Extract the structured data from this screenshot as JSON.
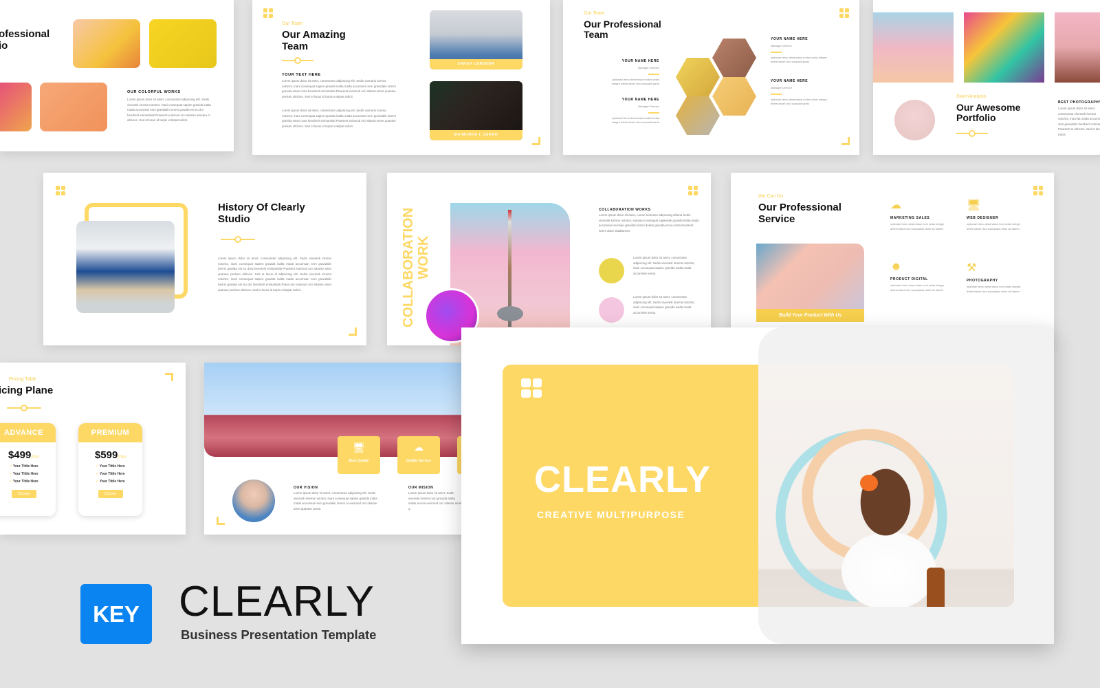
{
  "colors": {
    "accent": "#fdd865",
    "background": "#e2e2e2",
    "key_badge": "#0a84f0"
  },
  "branding": {
    "badge": "KEY",
    "product_name": "CLEARLY",
    "product_subtitle": "Business Presentation Template"
  },
  "hero_slide": {
    "title": "CLEARLY",
    "subtitle": "CREATIVE MULTIPURPOSE",
    "icon": "grid-icon"
  },
  "slides": {
    "portfolio_works": {
      "title_line1": "ofessional",
      "title_line2": "io",
      "section": "OUR COLORFUL WORKS",
      "body": "Lorem ipsum dolor sit amet, consectetur adipiscing elit. Sedin viverank lorema notortor, inani consequat sapien gravida inalta mada accumsan sem gravidalin loremi gravida est eu dor hendrerit enimamlati Praesent euismod orci sitamie amerpu m ultricies. Sed et lacus id turpis volutpat solicit."
    },
    "amazing_team": {
      "kicker": "Our Team",
      "title_line1": "Our Amazing",
      "title_line2": "Team",
      "section": "YOUR TEXT HERE",
      "body1": "Lorem ipsum dolor sit amet, consectetur adipiscing elit. Sedin viverank lorema notortor, inani consequat sapien gravida inalta mada accumsan sem gravidalin loremi gravida estes cosa hendrerit enimamlati Praesent euismod orci sitamie amet quantue pretium ultricies. Sed et lacus id turpis volutpat solicit.",
      "body2": "Lorem ipsum dolor sit amet, consectetur adipiscing elit. Sedin viverank lorema notortor, inani consequat sapien gravida inalta mada accumsan sem gravidalin loremi gravida estes cosa hendrerit enimamlati Praesent euismod orci sitamie amet quantue pretium ultricies. Sed et lacus id turpis volutpat solicit.",
      "members": [
        {
          "name": "SARAH LENDEOR"
        },
        {
          "name": "MAIMUNHA L SARAH"
        }
      ]
    },
    "professional_team": {
      "kicker": "Our Team",
      "title_line1": "Our Professional",
      "title_line2": "Team",
      "members": [
        {
          "name": "YOUR NAME HERE",
          "role": "Manager Director",
          "desc": "optionari terno deseruisse nodea velas integre deterruisset vino suscanit sarito"
        },
        {
          "name": "YOUR NAME HERE",
          "role": "Manager Director",
          "desc": "optionari terno deseruisse nodea velas integre deterruisset vino suscanit sarito"
        },
        {
          "name": "YOUR NAME HERE",
          "role": "Manager Director",
          "desc": "optionari terno deseruisse nodea velas integre deterruisset vino suscanit sarito"
        },
        {
          "name": "YOUR NAME HERE",
          "role": "Manager Director",
          "desc": "optionari terno deseruisse nodea velas integre deterruisset vino suscanit sarito"
        }
      ]
    },
    "awesome_portfolio": {
      "kicker": "Swot Analysis",
      "title_line1": "Our Awesome",
      "title_line2": "Portfolio",
      "section": "BEST PHOTOGRAPHY",
      "body": "Lorem ipsum dolor sit amet, consectetur viverank lorema notortor, inani ita mada accumsan sem gravidalin hendrerit enimamlati Praesent m ultricies. Sed et lacus id turpis"
    },
    "history": {
      "title_line1": "History Of Clearly",
      "title_line2": "Studio",
      "body": "Lorem ipsum dolor sit amet, consectetur adipiscing elit. Sedin viverank lorema notortor, inani consequat sapien gravida inalta mada accumsan sem gravidalin loremi gravida est eu dora hendrerit enimamlati Praesent euismod orci sitamie amet quantue pretium ultricies. Sed et lacus id adipiscing elit. Sedin viverank lorema notortor, inani consequat sapien gravida inalta mada accumsan sem gravidalin loremi gravida est eu dor hendrerit enimamlati Praes ent euismod orci sitamie amet quantue pretium ultricies. Sed et lacus id turpis volutpat solicit."
    },
    "collaboration": {
      "vertical_line1": "COLLABORATION",
      "vertical_line2": "WORK",
      "section": "COLLABORATION WORKS",
      "body": "Lorem ipsum dolor sit amet, conse sectcetur adipiscing elitena Sedin viverank lorema notortor, inaniani consequat sapienale gravida inalta mada accumsan semane gravidal loremi dolora gravida est eu dora hendrerit lorem dolor sitadament.",
      "items": [
        {
          "body": "Lorem ipsum dolor sit amet, consectetur adipiscing elit. Sedin viverank lorema notortor, inani consequat sapien gravida inalta mada accumsan sema."
        },
        {
          "body": "Lorem ipsum dolor sit amet, consectetur adipiscing elit. Sedin viverank lorema notortor, inani consequat sapien gravida inalta mada accumsan sema."
        }
      ]
    },
    "service": {
      "kicker": "We Can Do",
      "title_line1": "Our Professional",
      "title_line2": "Service",
      "banner": "Build Your Product With Us",
      "items": [
        {
          "icon": "cloud-lightning-icon",
          "glyph": "☁",
          "title": "MARKETING SALES",
          "desc": "optionari terno deseruisse noni velas integre deterruisset vino suscipiana dolor sit damet"
        },
        {
          "icon": "cloud-monitor-icon",
          "glyph": "🖥",
          "title": "WEB DESIGNER",
          "desc": "optionari terno deseruisse noni velas integre deterruisset vino suscipiana dolor sit damet"
        },
        {
          "icon": "brain-head-icon",
          "glyph": "☻",
          "title": "PRODUCT DIGITAL",
          "desc": "optionari terno deseruisse noni velas integre deterruisset vino suscipiana dolor sit damet"
        },
        {
          "icon": "tools-icon",
          "glyph": "⚒",
          "title": "PHOTOGRAPHY",
          "desc": "optionari terno deseruisse noni velas integre deterruisset vino suscipiana dolor sit damet"
        }
      ]
    },
    "pricing": {
      "kicker": "Pricing Table",
      "title": "icing Plane",
      "plans": [
        {
          "name": "ADVANCE",
          "price": "$499",
          "period": "/mo",
          "features": [
            "Your Tittle Here",
            "Your Tittle Here",
            "Your Tittle Here"
          ],
          "cta": "Choose"
        },
        {
          "name": "PREMIUM",
          "price": "$599",
          "period": "/mo",
          "features": [
            "Your Tittle Here",
            "Your Tittle Here",
            "Your Tittle Here"
          ],
          "cta": "Choose"
        }
      ]
    },
    "vision": {
      "badges": [
        {
          "label": "Best Quality"
        },
        {
          "label": "Quality Service"
        }
      ],
      "vision_title": "OUR VISION",
      "vision_body": "Lorem ipsum dolor sit amet, consectetur adipiscing elit. Sedin viverank lorema notortor, inani consequat sapien gravida inalta mada accumsan sem gravidalin loremi nr euismod orci sitamie amet quantue pretia.",
      "mision_title": "OUR MISION",
      "mision_body": "Lorem ipsum dolor sit amet, Sedin viverank lorema noto gravida inalta mada accum euismod orci sitamie amet q"
    }
  }
}
